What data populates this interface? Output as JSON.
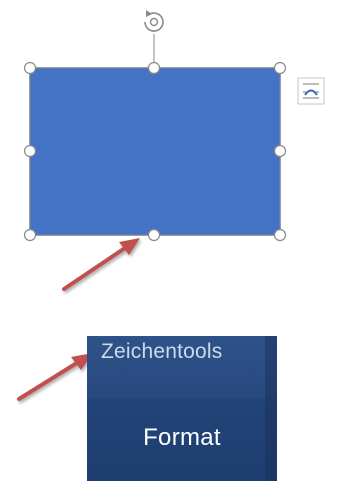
{
  "colors": {
    "shape_fill": "#4472c4",
    "shape_border": "#3a66b2",
    "handle_fill": "#ffffff",
    "handle_stroke": "#8a8a8a",
    "arrow": "#c0504d",
    "ribbon_bg": "#2a4c80",
    "ribbon_label": "#cdd9ec",
    "ribbon_tab_text": "#ffffff"
  },
  "icons": {
    "rotate": "rotate-handle-icon",
    "layout_options": "layout-options-icon",
    "arrow": "red-pointer-arrow"
  },
  "ribbon": {
    "group_label": "Zeichentools",
    "tab_label": "Format"
  }
}
